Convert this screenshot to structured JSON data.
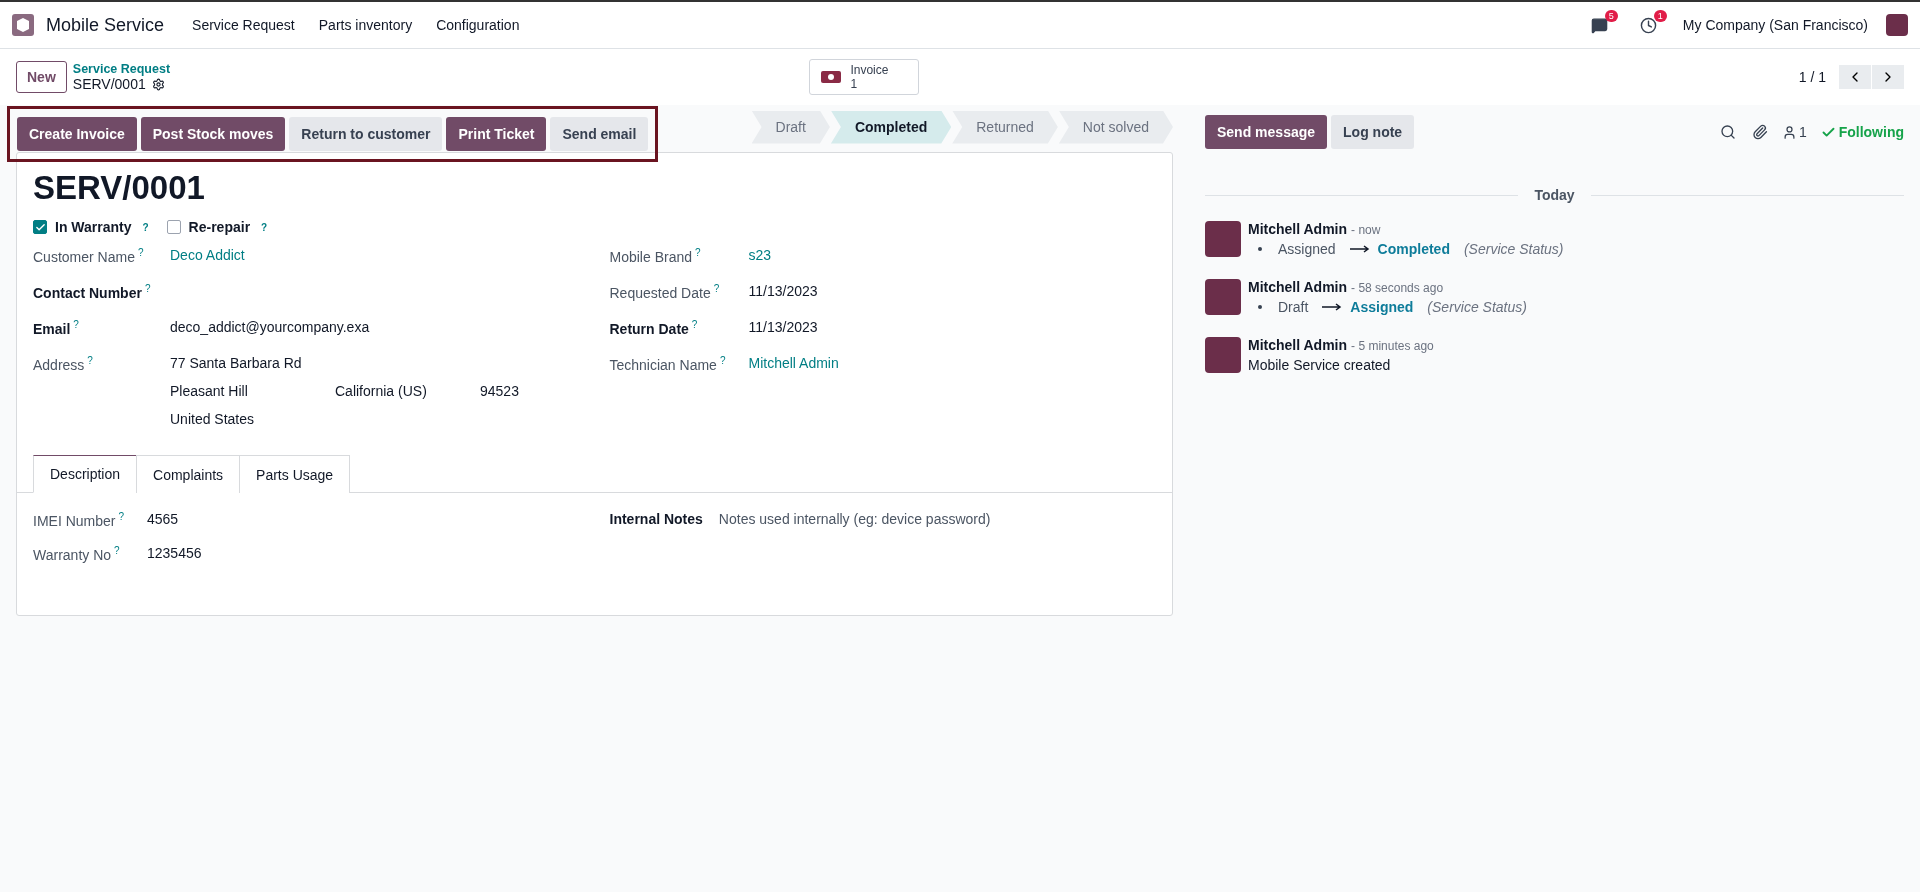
{
  "nav": {
    "app_name": "Mobile Service",
    "menu": [
      "Service Request",
      "Parts inventory",
      "Configuration"
    ],
    "message_count": "5",
    "activity_count": "1",
    "company": "My Company (San Francisco)"
  },
  "control": {
    "new_button": "New",
    "breadcrumb": "Service Request",
    "record": "SERV/0001",
    "smart_button": {
      "label": "Invoice",
      "count": "1"
    },
    "pager": "1 / 1"
  },
  "actions": [
    {
      "label": "Create Invoice",
      "primary": true
    },
    {
      "label": "Post Stock moves",
      "primary": true
    },
    {
      "label": "Return to customer",
      "primary": false
    },
    {
      "label": "Print Ticket",
      "primary": true
    },
    {
      "label": "Send email",
      "primary": false
    }
  ],
  "status_steps": [
    {
      "label": "Draft",
      "selected": false
    },
    {
      "label": "Completed",
      "selected": true
    },
    {
      "label": "Returned",
      "selected": false
    },
    {
      "label": "Not solved",
      "selected": false
    }
  ],
  "form": {
    "title": "SERV/0001",
    "checkboxes": [
      {
        "label": "In Warranty",
        "help": "?",
        "checked": true
      },
      {
        "label": "Re-repair",
        "help": "?",
        "checked": false
      }
    ],
    "left_fields": [
      {
        "label": "Customer Name",
        "help": "?",
        "value": "Deco Addict",
        "link": true,
        "required": false
      },
      {
        "label": "Contact Number",
        "help": "?",
        "required": true
      },
      {
        "label": "Email",
        "help": "?",
        "value": "deco_addict@yourcompany.exa",
        "link": false,
        "required": true
      }
    ],
    "address": {
      "label": "Address",
      "help": "?",
      "street": "77 Santa Barbara Rd",
      "city": "Pleasant Hill",
      "state": "California (US)",
      "zip": "94523",
      "country": "United States"
    },
    "right_fields": [
      {
        "label": "Mobile Brand",
        "help": "?",
        "value": "s23",
        "link": true,
        "required": false
      },
      {
        "label": "Requested Date",
        "help": "?",
        "value": "11/13/2023",
        "link": false,
        "required": false
      },
      {
        "label": "Return Date",
        "help": "?",
        "value": "11/13/2023",
        "link": false,
        "required": true
      },
      {
        "label": "Technician Name",
        "help": "?",
        "value": "Mitchell Admin",
        "link": true,
        "required": false
      }
    ],
    "tabs": [
      {
        "label": "Description",
        "selected": true
      },
      {
        "label": "Complaints",
        "selected": false
      },
      {
        "label": "Parts Usage",
        "selected": false
      }
    ],
    "tab_fields": [
      {
        "label": "IMEI Number",
        "help": "?",
        "value": "4565"
      },
      {
        "label": "Warranty No",
        "help": "?",
        "value": "1235456"
      }
    ],
    "notes": {
      "label": "Internal Notes",
      "placeholder": "Notes used internally (eg: device password)"
    }
  },
  "chatter": {
    "send_message": "Send message",
    "log_note": "Log note",
    "followers": "1",
    "following": "Following",
    "date_separator": "Today",
    "messages": [
      {
        "author": "Mitchell Admin",
        "time": "- now",
        "change": {
          "old": "Assigned",
          "new": "Completed",
          "field": "(Service Status)"
        }
      },
      {
        "author": "Mitchell Admin",
        "time": "- 58 seconds ago",
        "change": {
          "old": "Draft",
          "new": "Assigned",
          "field": "(Service Status)"
        }
      },
      {
        "author": "Mitchell Admin",
        "time": "- 5 minutes ago",
        "body": "Mobile Service created"
      }
    ]
  }
}
